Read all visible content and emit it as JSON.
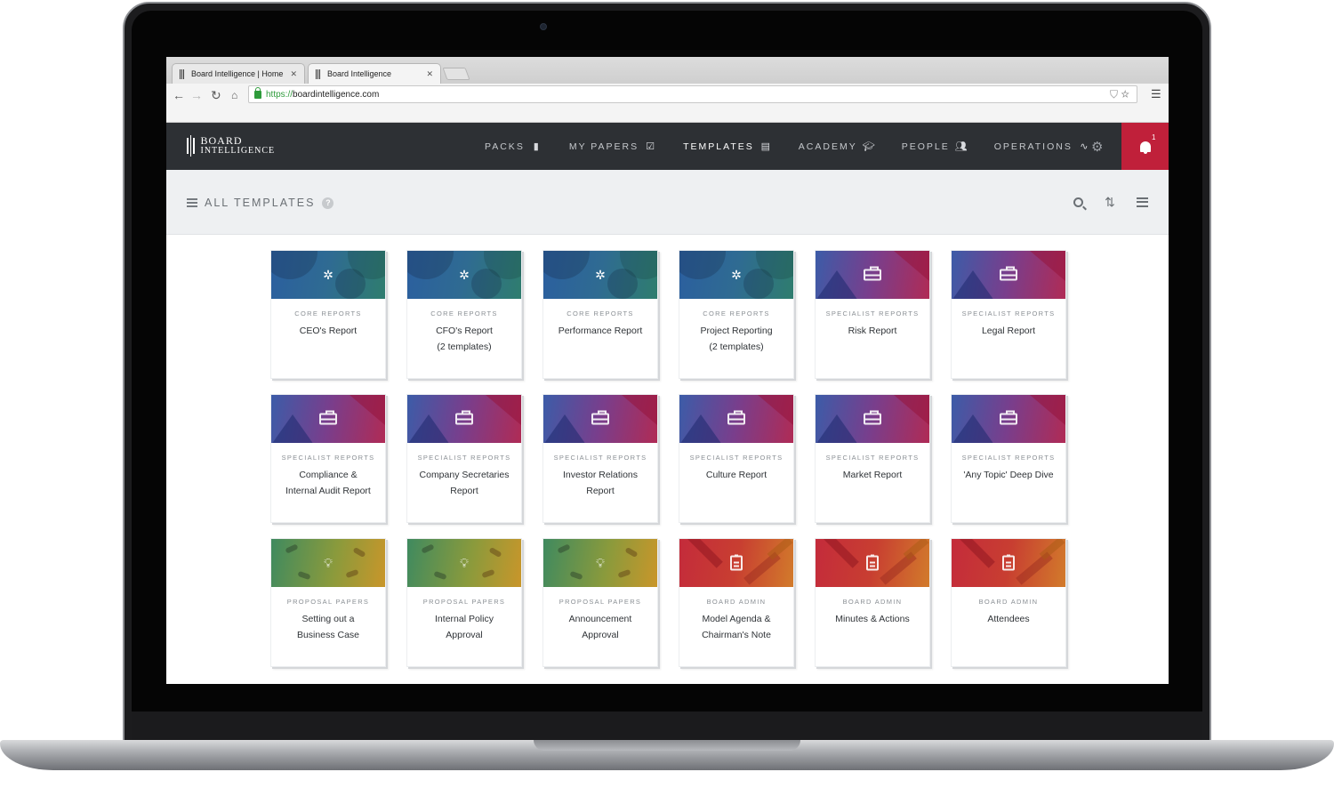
{
  "browser": {
    "tabs": [
      {
        "label": "Board Intelligence | Home",
        "active": false
      },
      {
        "label": "Board Intelligence",
        "active": true
      }
    ],
    "url_scheme": "https://",
    "url_rest": "boardintelligence.com"
  },
  "header": {
    "brand_line1": "BOARD",
    "brand_line2": "INTELLIGENCE",
    "nav": [
      {
        "label": "PACKS",
        "icon": "book-icon"
      },
      {
        "label": "MY PAPERS",
        "icon": "checkbox-icon"
      },
      {
        "label": "TEMPLATES",
        "icon": "template-icon",
        "active": true
      },
      {
        "label": "ACADEMY",
        "icon": "graduation-cap-icon"
      },
      {
        "label": "PEOPLE",
        "icon": "people-icon"
      },
      {
        "label": "OPERATIONS",
        "icon": "pulse-icon"
      }
    ],
    "notification_count": "1"
  },
  "subheader": {
    "title": "ALL TEMPLATES",
    "help": "?"
  },
  "templates": [
    {
      "category": "CORE REPORTS",
      "title": [
        "CEO's Report"
      ],
      "type": "core",
      "icon": "network-icon"
    },
    {
      "category": "CORE REPORTS",
      "title": [
        "CFO's Report",
        "(2 templates)"
      ],
      "type": "core",
      "icon": "network-icon"
    },
    {
      "category": "CORE REPORTS",
      "title": [
        "Performance Report"
      ],
      "type": "core",
      "icon": "network-icon"
    },
    {
      "category": "CORE REPORTS",
      "title": [
        "Project Reporting",
        "(2 templates)"
      ],
      "type": "core",
      "icon": "network-icon"
    },
    {
      "category": "SPECIALIST REPORTS",
      "title": [
        "Risk Report"
      ],
      "type": "specialist",
      "icon": "briefcase-icon"
    },
    {
      "category": "SPECIALIST REPORTS",
      "title": [
        "Legal Report"
      ],
      "type": "specialist",
      "icon": "briefcase-icon"
    },
    {
      "category": "SPECIALIST REPORTS",
      "title": [
        "Compliance &",
        "Internal Audit Report"
      ],
      "type": "specialist",
      "icon": "briefcase-icon"
    },
    {
      "category": "SPECIALIST REPORTS",
      "title": [
        "Company Secretaries",
        "Report"
      ],
      "type": "specialist",
      "icon": "briefcase-icon"
    },
    {
      "category": "SPECIALIST REPORTS",
      "title": [
        "Investor Relations",
        "Report"
      ],
      "type": "specialist",
      "icon": "briefcase-icon"
    },
    {
      "category": "SPECIALIST REPORTS",
      "title": [
        "Culture Report"
      ],
      "type": "specialist",
      "icon": "briefcase-icon"
    },
    {
      "category": "SPECIALIST REPORTS",
      "title": [
        "Market Report"
      ],
      "type": "specialist",
      "icon": "briefcase-icon"
    },
    {
      "category": "SPECIALIST REPORTS",
      "title": [
        "'Any Topic' Deep Dive"
      ],
      "type": "specialist",
      "icon": "briefcase-icon"
    },
    {
      "category": "PROPOSAL PAPERS",
      "title": [
        "Setting out a",
        "Business Case"
      ],
      "type": "proposal",
      "icon": "lightbulb-icon"
    },
    {
      "category": "PROPOSAL PAPERS",
      "title": [
        "Internal Policy",
        "Approval"
      ],
      "type": "proposal",
      "icon": "lightbulb-icon"
    },
    {
      "category": "PROPOSAL PAPERS",
      "title": [
        "Announcement",
        "Approval"
      ],
      "type": "proposal",
      "icon": "lightbulb-icon"
    },
    {
      "category": "BOARD ADMIN",
      "title": [
        "Model Agenda &",
        "Chairman's Note"
      ],
      "type": "admin",
      "icon": "clipboard-icon"
    },
    {
      "category": "BOARD ADMIN",
      "title": [
        "Minutes & Actions"
      ],
      "type": "admin",
      "icon": "clipboard-icon"
    },
    {
      "category": "BOARD ADMIN",
      "title": [
        "Attendees"
      ],
      "type": "admin",
      "icon": "clipboard-icon"
    }
  ]
}
